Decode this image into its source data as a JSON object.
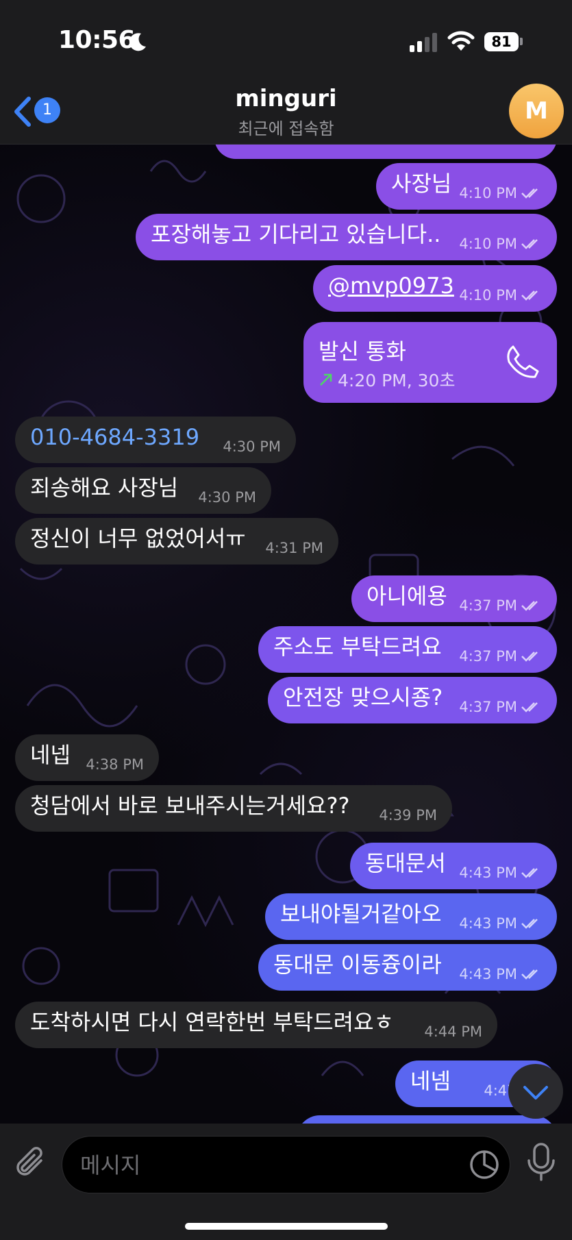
{
  "status_bar": {
    "time": "10:56",
    "battery": "81"
  },
  "header": {
    "back_badge": "1",
    "title": "minguri",
    "subtitle": "최근에 접속함",
    "avatar_letter": "M"
  },
  "messages": [
    {
      "dir": "out",
      "text": "사장님",
      "time": "4:10 PM"
    },
    {
      "dir": "out",
      "text": "포장해놓고 기다리고 있습니다..",
      "time": "4:10 PM"
    },
    {
      "dir": "out",
      "text": "@mvp0973",
      "time": "4:10 PM"
    },
    {
      "dir": "in",
      "text": "010-4684-3319",
      "time": "4:30 PM"
    },
    {
      "dir": "in",
      "text": "죄송해요 사장님",
      "time": "4:30 PM"
    },
    {
      "dir": "in",
      "text": "정신이 너무 없었어서ㅠ",
      "time": "4:31 PM"
    },
    {
      "dir": "out",
      "text": "아니에용",
      "time": "4:37 PM"
    },
    {
      "dir": "out",
      "text": "주소도 부탁드려요",
      "time": "4:37 PM"
    },
    {
      "dir": "out",
      "text": "안전장 맞으시죵?",
      "time": "4:37 PM"
    },
    {
      "dir": "in",
      "text": "네넵",
      "time": "4:38 PM"
    },
    {
      "dir": "in",
      "text": "청담에서 바로 보내주시는거세요??",
      "time": "4:39 PM"
    },
    {
      "dir": "out",
      "text": "동대문서",
      "time": "4:43 PM"
    },
    {
      "dir": "out",
      "text": "보내야될거같아오",
      "time": "4:43 PM"
    },
    {
      "dir": "out",
      "text": "동대문 이동즁이라",
      "time": "4:43 PM"
    },
    {
      "dir": "in",
      "text": "도착하시면 다시 연락한번 부탁드려요ㅎ",
      "time": "4:44 PM"
    },
    {
      "dir": "out",
      "text": "네넴",
      "time": "4:47 PM"
    }
  ],
  "call": {
    "title": "발신 통화",
    "detail": "4:20 PM, 30초"
  },
  "composer": {
    "placeholder": "메시지"
  },
  "icons": {
    "back": "chevron-left-icon",
    "call": "phone-icon",
    "attach": "paperclip-icon",
    "sticker": "sticker-icon",
    "mic": "microphone-icon",
    "scroll": "chevron-down-icon"
  },
  "colors": {
    "accent": "#3e82f6",
    "link": "#6ea8ff",
    "call_arrow": "#4cd964",
    "avatar": "#f0a33e"
  }
}
